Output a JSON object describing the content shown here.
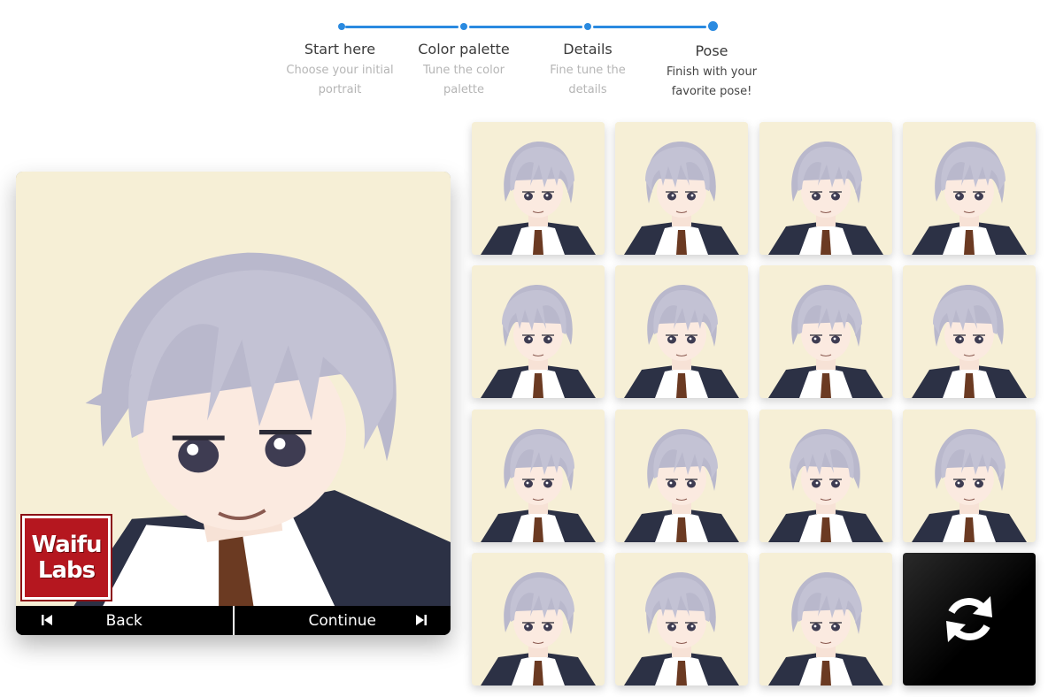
{
  "steps": [
    {
      "title": "Start here",
      "subtitle": "Choose your initial portrait"
    },
    {
      "title": "Color palette",
      "subtitle": "Tune the color palette"
    },
    {
      "title": "Details",
      "subtitle": "Fine tune the details"
    },
    {
      "title": "Pose",
      "subtitle": "Finish with your favorite pose!"
    }
  ],
  "current_step": 4,
  "accent_color": "#2a8ae0",
  "portrait": {
    "hair_color": "#b9b8cc",
    "background_color": "#f6efd6",
    "logo": {
      "line1": "Waifu",
      "line2": "Labs"
    }
  },
  "nav": {
    "back_label": "Back",
    "continue_label": "Continue",
    "back_icon": "skip-back-icon",
    "continue_icon": "skip-forward-icon"
  },
  "grid": {
    "thumbnail_count": 15,
    "refresh_icon": "refresh-icon"
  }
}
